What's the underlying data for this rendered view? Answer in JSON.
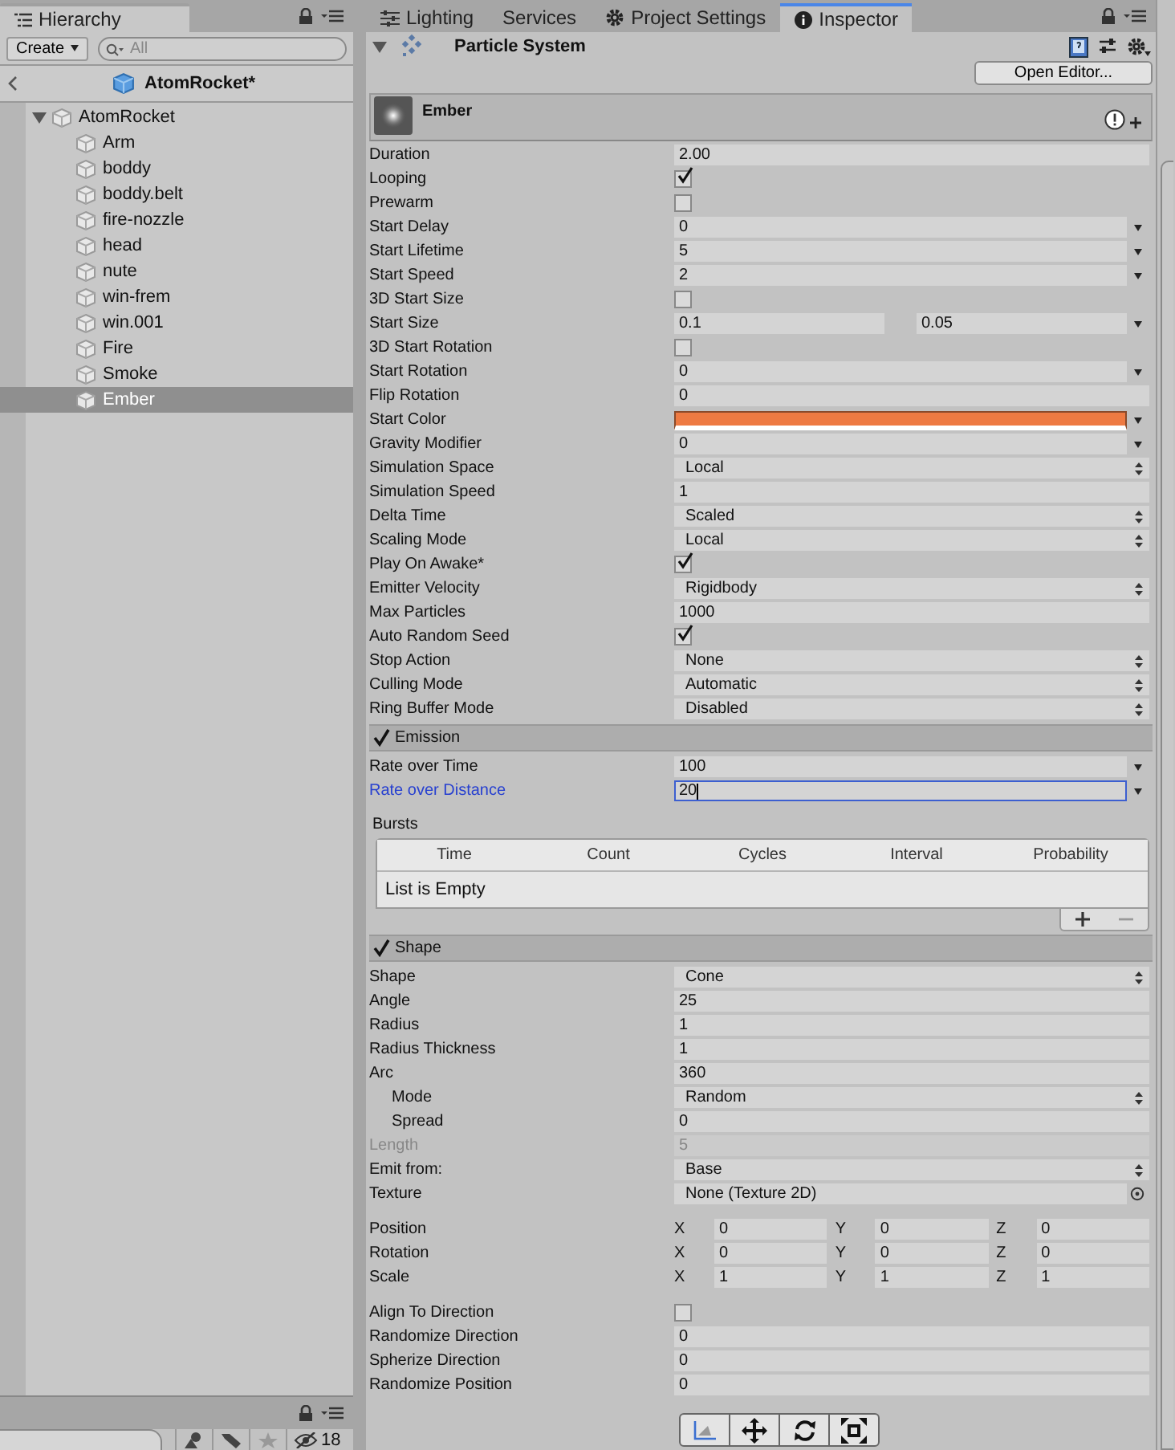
{
  "hierarchy": {
    "tab": {
      "label": "Hierarchy",
      "selected": true
    },
    "create_button": "Create",
    "search": {
      "placeholder": "All"
    },
    "scene": "AtomRocket*",
    "tree": [
      {
        "label": "AtomRocket",
        "expanded": true,
        "selected": false,
        "children": [
          {
            "label": "Arm",
            "selected": false
          },
          {
            "label": "boddy",
            "selected": false
          },
          {
            "label": "boddy.belt",
            "selected": false
          },
          {
            "label": "fire-nozzle",
            "selected": false
          },
          {
            "label": "head",
            "selected": false
          },
          {
            "label": "nute",
            "selected": false
          },
          {
            "label": "win-frem",
            "selected": false
          },
          {
            "label": "win.001",
            "selected": false
          },
          {
            "label": "Fire",
            "selected": false
          },
          {
            "label": "Smoke",
            "selected": false
          },
          {
            "label": "Ember",
            "selected": true
          }
        ]
      }
    ]
  },
  "project_panel": {
    "hidden_count": "18"
  },
  "tabs": [
    {
      "label": "Lighting",
      "selected": false
    },
    {
      "label": "Services",
      "selected": false
    },
    {
      "label": "Project Settings",
      "selected": false
    },
    {
      "label": "Inspector",
      "selected": true
    }
  ],
  "inspector": {
    "component": "Particle System",
    "expanded": true,
    "open_editor_button": "Open Editor...",
    "system_name": "Ember",
    "main_rows": [
      {
        "label": "Duration",
        "kind": "number",
        "value": "2.00",
        "disabled": false,
        "focused": false
      },
      {
        "label": "Looping",
        "kind": "checkbox",
        "checked": true,
        "disabled": false,
        "focused": false
      },
      {
        "label": "Prewarm",
        "kind": "checkbox",
        "checked": false,
        "disabled": false,
        "focused": false
      },
      {
        "label": "Start Delay",
        "kind": "curve",
        "value": "0",
        "disabled": false,
        "focused": false
      },
      {
        "label": "Start Lifetime",
        "kind": "curve",
        "value": "5",
        "disabled": false,
        "focused": false
      },
      {
        "label": "Start Speed",
        "kind": "curve",
        "value": "2",
        "disabled": false,
        "focused": false
      },
      {
        "label": "3D Start Size",
        "kind": "checkbox",
        "checked": false,
        "disabled": false,
        "focused": false
      },
      {
        "label": "Start Size",
        "kind": "range",
        "values": [
          "0.1",
          "0.05"
        ],
        "disabled": false,
        "focused": false
      },
      {
        "label": "3D Start Rotation",
        "kind": "checkbox",
        "checked": false,
        "disabled": false,
        "focused": false
      },
      {
        "label": "Start Rotation",
        "kind": "curve",
        "value": "0",
        "disabled": false,
        "focused": false
      },
      {
        "label": "Flip Rotation",
        "kind": "number",
        "value": "0",
        "disabled": false,
        "focused": false
      },
      {
        "label": "Start Color",
        "kind": "color",
        "color": "#ee7a42",
        "disabled": false,
        "focused": false
      },
      {
        "label": "Gravity Modifier",
        "kind": "curve",
        "value": "0",
        "disabled": false,
        "focused": false
      },
      {
        "label": "Simulation Space",
        "kind": "enum",
        "value": "Local",
        "disabled": false,
        "focused": false
      },
      {
        "label": "Simulation Speed",
        "kind": "number",
        "value": "1",
        "disabled": false,
        "focused": false
      },
      {
        "label": "Delta Time",
        "kind": "enum",
        "value": "Scaled",
        "disabled": false,
        "focused": false
      },
      {
        "label": "Scaling Mode",
        "kind": "enum",
        "value": "Local",
        "disabled": false,
        "focused": false
      },
      {
        "label": "Play On Awake*",
        "kind": "checkbox",
        "checked": true,
        "disabled": false,
        "focused": false
      },
      {
        "label": "Emitter Velocity",
        "kind": "enum",
        "value": "Rigidbody",
        "disabled": false,
        "focused": false
      },
      {
        "label": "Max Particles",
        "kind": "number",
        "value": "1000",
        "disabled": false,
        "focused": false
      },
      {
        "label": "Auto Random Seed",
        "kind": "checkbox",
        "checked": true,
        "disabled": false,
        "focused": false
      },
      {
        "label": "Stop Action",
        "kind": "enum",
        "value": "None",
        "disabled": false,
        "focused": false
      },
      {
        "label": "Culling Mode",
        "kind": "enum",
        "value": "Automatic",
        "disabled": false,
        "focused": false
      },
      {
        "label": "Ring Buffer Mode",
        "kind": "enum",
        "value": "Disabled",
        "disabled": false,
        "focused": false
      }
    ],
    "modules": [
      {
        "title": "Emission",
        "enabled": true,
        "groups": [
          [
            {
              "label": "Rate over Time",
              "kind": "curve",
              "value": "100",
              "disabled": false,
              "focused": false
            },
            {
              "label": "Rate over Distance",
              "kind": "curve",
              "value": "20",
              "disabled": false,
              "focused": true
            }
          ]
        ],
        "bursts": {
          "label": "Bursts",
          "columns": [
            "Time",
            "Count",
            "Cycles",
            "Interval",
            "Probability"
          ],
          "empty_text": "List is Empty"
        }
      },
      {
        "title": "Shape",
        "enabled": true,
        "edit_tools": true,
        "groups": [
          [
            {
              "label": "Shape",
              "kind": "enum",
              "value": "Cone",
              "disabled": false,
              "focused": false
            },
            {
              "label": "Angle",
              "kind": "number",
              "value": "25",
              "disabled": false,
              "focused": false
            },
            {
              "label": "Radius",
              "kind": "number",
              "value": "1",
              "disabled": false,
              "focused": false
            },
            {
              "label": "Radius Thickness",
              "kind": "number",
              "value": "1",
              "disabled": false,
              "focused": false
            },
            {
              "label": "Arc",
              "kind": "number",
              "value": "360",
              "disabled": false,
              "focused": false,
              "children": [
                {
                  "label": "Mode",
                  "kind": "enum",
                  "value": "Random",
                  "disabled": false,
                  "focused": false
                },
                {
                  "label": "Spread",
                  "kind": "number",
                  "value": "0",
                  "disabled": false,
                  "focused": false
                }
              ]
            },
            {
              "label": "Length",
              "kind": "number",
              "value": "5",
              "disabled": true,
              "focused": false
            },
            {
              "label": "Emit from:",
              "kind": "enum",
              "value": "Base",
              "disabled": false,
              "focused": false
            },
            {
              "label": "Texture",
              "kind": "object",
              "value": "None (Texture 2D)",
              "disabled": false,
              "focused": false
            }
          ],
          [
            {
              "label": "Position",
              "kind": "vector",
              "axes": [
                {
                  "axis": "X",
                  "value": "0"
                },
                {
                  "axis": "Y",
                  "value": "0"
                },
                {
                  "axis": "Z",
                  "value": "0"
                }
              ],
              "disabled": false,
              "focused": false
            },
            {
              "label": "Rotation",
              "kind": "vector",
              "axes": [
                {
                  "axis": "X",
                  "value": "0"
                },
                {
                  "axis": "Y",
                  "value": "0"
                },
                {
                  "axis": "Z",
                  "value": "0"
                }
              ],
              "disabled": false,
              "focused": false
            },
            {
              "label": "Scale",
              "kind": "vector",
              "axes": [
                {
                  "axis": "X",
                  "value": "1"
                },
                {
                  "axis": "Y",
                  "value": "1"
                },
                {
                  "axis": "Z",
                  "value": "1"
                }
              ],
              "disabled": false,
              "focused": false
            }
          ],
          [
            {
              "label": "Align To Direction",
              "kind": "checkbox",
              "checked": false,
              "disabled": false,
              "focused": false
            },
            {
              "label": "Randomize Direction",
              "kind": "number",
              "value": "0",
              "disabled": false,
              "focused": false
            },
            {
              "label": "Spherize Direction",
              "kind": "number",
              "value": "0",
              "disabled": false,
              "focused": false
            },
            {
              "label": "Randomize Position",
              "kind": "number",
              "value": "0",
              "disabled": false,
              "focused": false
            }
          ]
        ]
      }
    ]
  }
}
